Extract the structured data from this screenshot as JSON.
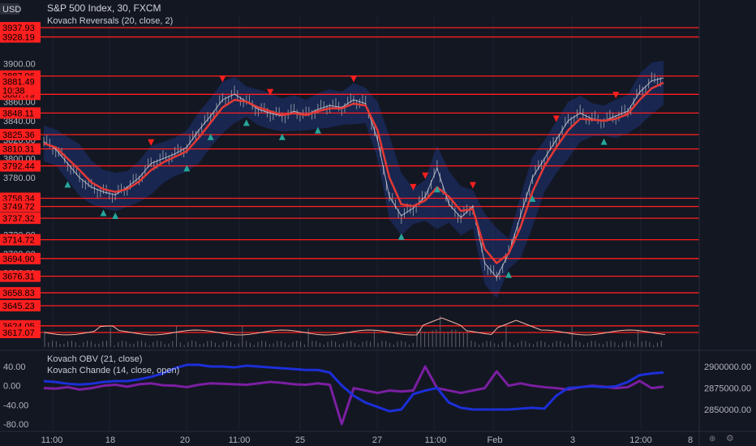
{
  "header": {
    "currency": "USD",
    "symbol_title": "S&P 500 Index, 30, FXCM",
    "indicator_main": "Kovach Reversals (20, close, 2)",
    "indicator_obv": "Kovach OBV (21, close)",
    "indicator_chande": "Kovach Chande (14, close, open)"
  },
  "colors": {
    "background": "#131722",
    "price_line": "#d1d4dc",
    "ma_line": "#e53935",
    "band_fill": "#1e3a8a",
    "level_line": "#ff1f1f",
    "level_label_bg": "#ff1f1f",
    "buy_marker": "#26a69a",
    "sell_marker": "#ff1f1f",
    "obv_line": "#1c2fd8",
    "chande_line": "#7b1fa2",
    "volume_line": "#f5b5a8"
  },
  "price_axis": {
    "ticks": [
      "3900.00",
      "3880.00",
      "3860.00",
      "3840.00",
      "3820.00",
      "3800.00",
      "3780.00",
      "3760.00",
      "3740.00",
      "3720.00",
      "3700.00",
      "3680.00"
    ],
    "last_price": "3881.49",
    "last_time": "10:38"
  },
  "levels": [
    "3937.93",
    "3928.19",
    "3887.06",
    "3867.79",
    "3848.11",
    "3825.36",
    "3810.31",
    "3792.44",
    "3758.34",
    "3749.72",
    "3737.32",
    "3714.72",
    "3694.90",
    "3676.31",
    "3658.83",
    "3645.23",
    "3624.05",
    "3617.07"
  ],
  "oscillator_axis_left": [
    "40.00",
    "0.00",
    "-40.00",
    "-80.00"
  ],
  "oscillator_axis_right": [
    "2900000.00",
    "2875000.00",
    "2850000.00"
  ],
  "time_axis": [
    "11:00",
    "18",
    "20",
    "11:00",
    "25",
    "27",
    "11:00",
    "Feb",
    "3",
    "12:00",
    "8"
  ],
  "chart_data": [
    {
      "type": "line",
      "title": "S&P 500 Index, 30, FXCM",
      "ylim": [
        3600,
        3950
      ],
      "series": [
        {
          "name": "close",
          "values": [
            3818,
            3810,
            3795,
            3780,
            3770,
            3765,
            3762,
            3770,
            3780,
            3795,
            3800,
            3805,
            3812,
            3830,
            3845,
            3862,
            3868,
            3860,
            3852,
            3848,
            3845,
            3850,
            3846,
            3852,
            3856,
            3854,
            3862,
            3858,
            3820,
            3760,
            3740,
            3748,
            3760,
            3790,
            3752,
            3738,
            3750,
            3690,
            3675,
            3700,
            3740,
            3780,
            3800,
            3820,
            3840,
            3848,
            3842,
            3840,
            3845,
            3850,
            3870,
            3882,
            3885
          ]
        },
        {
          "name": "Kovach Reversals",
          "values": [
            3816,
            3812,
            3800,
            3788,
            3775,
            3768,
            3765,
            3768,
            3776,
            3788,
            3796,
            3802,
            3808,
            3822,
            3838,
            3854,
            3862,
            3860,
            3854,
            3850,
            3846,
            3848,
            3846,
            3850,
            3853,
            3853,
            3858,
            3856,
            3830,
            3780,
            3752,
            3750,
            3756,
            3770,
            3760,
            3745,
            3747,
            3705,
            3690,
            3700,
            3728,
            3765,
            3792,
            3812,
            3830,
            3842,
            3841,
            3840,
            3842,
            3847,
            3862,
            3874,
            3880
          ]
        }
      ]
    },
    {
      "type": "line",
      "title": "Kovach Chande (14, close, open)",
      "ylim": [
        -90,
        55
      ],
      "series": [
        {
          "name": "Kovach Chande",
          "values": [
            -5,
            -6,
            -3,
            -8,
            -5,
            0,
            2,
            -2,
            3,
            5,
            1,
            0,
            -3,
            2,
            5,
            4,
            3,
            2,
            5,
            8,
            6,
            3,
            2,
            5,
            2,
            -80,
            -5,
            -10,
            -15,
            -10,
            -12,
            -10,
            40,
            -5,
            -10,
            -15,
            -10,
            -5,
            30,
            0,
            5,
            0,
            -3,
            -5,
            -8,
            -3,
            0,
            -2,
            -5,
            -3,
            10,
            -5,
            -2
          ]
        },
        {
          "name": "Kovach OBV",
          "values": [
            2883000,
            2882000,
            2880000,
            2879000,
            2880000,
            2882000,
            2883000,
            2883000,
            2885000,
            2888000,
            2892000,
            2898000,
            2902000,
            2902000,
            2900000,
            2900000,
            2899000,
            2901000,
            2900000,
            2899000,
            2898000,
            2897000,
            2896000,
            2896000,
            2893000,
            2878000,
            2866000,
            2858000,
            2853000,
            2848000,
            2850000,
            2868000,
            2872000,
            2875000,
            2858000,
            2852000,
            2850000,
            2850000,
            2850000,
            2850000,
            2851000,
            2852000,
            2851000,
            2866000,
            2875000,
            2876000,
            2877000,
            2876000,
            2877000,
            2882000,
            2890000,
            2892000,
            2893000
          ]
        }
      ]
    }
  ]
}
